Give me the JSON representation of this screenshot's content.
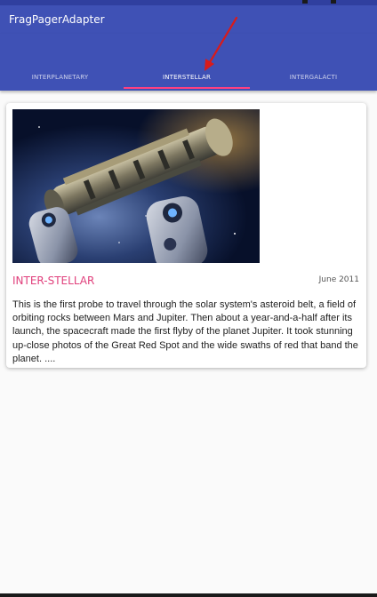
{
  "app_bar": {
    "title": "FragPagerAdapter"
  },
  "tabs": [
    {
      "label": "INTERPLANETARY",
      "active": false
    },
    {
      "label": "INTERSTELLAR",
      "active": true
    },
    {
      "label": "INTERGALACTI",
      "active": false
    }
  ],
  "colors": {
    "primary": "#3f51b5",
    "primary_dark": "#303f9f",
    "accent": "#ff4081",
    "annotation_arrow": "#d81b1b"
  },
  "card": {
    "image_icon": "spaceship-image",
    "title": "INTER-STELLAR",
    "date": "June 2011",
    "body": "This is the first probe to travel through the solar system's asteroid belt, a field of orbiting rocks between Mars and Jupiter. Then about a year-and-a-half after its launch, the spacecraft made the first flyby of the planet Jupiter. It took stunning up-close photos of the Great Red Spot and the wide swaths of red that band the planet. ...."
  }
}
